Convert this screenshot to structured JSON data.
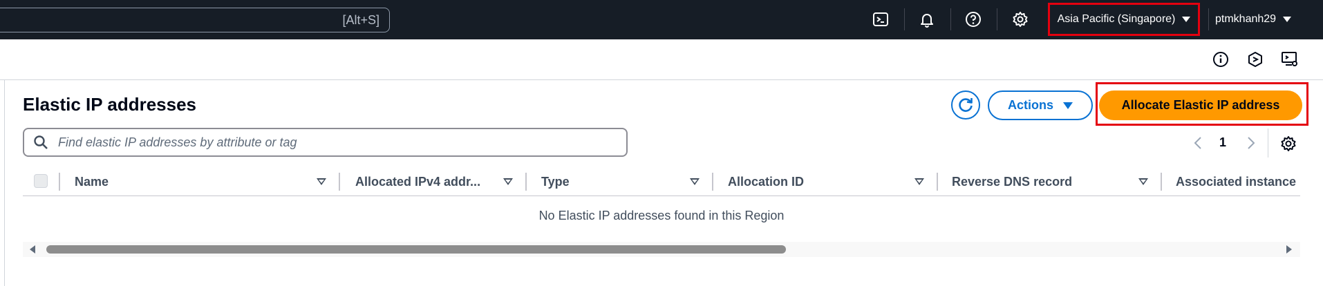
{
  "topbar": {
    "search_shortcut": "[Alt+S]",
    "region": "Asia Pacific (Singapore)",
    "user": "ptmkhanh29",
    "icons": [
      "cloudshell-icon",
      "bell-icon",
      "help-icon",
      "gear-icon"
    ]
  },
  "utility": {
    "icons": [
      "info-icon",
      "notifications-hexagon-icon",
      "display-settings-icon"
    ]
  },
  "page": {
    "title": "Elastic IP addresses",
    "actions_label": "Actions",
    "allocate_label": "Allocate Elastic IP address",
    "filter_placeholder": "Find elastic IP addresses by attribute or tag",
    "page_number": "1"
  },
  "table": {
    "columns": [
      {
        "label": "Name"
      },
      {
        "label": "Allocated IPv4 addr..."
      },
      {
        "label": "Type"
      },
      {
        "label": "Allocation ID"
      },
      {
        "label": "Reverse DNS record"
      },
      {
        "label": "Associated instance I"
      }
    ],
    "empty_message": "No Elastic IP addresses found in this Region"
  },
  "colors": {
    "topbar_bg": "#161d26",
    "accent_blue": "#0972d3",
    "primary_orange": "#ff9900",
    "highlight_red": "#e4000f"
  }
}
